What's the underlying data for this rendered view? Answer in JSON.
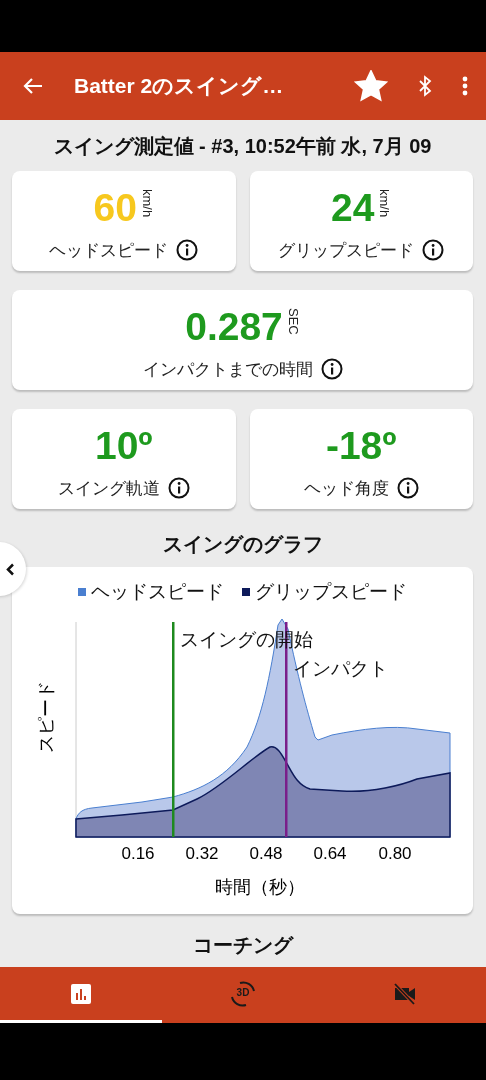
{
  "app_bar": {
    "title": "Batter 2のスイング…",
    "favorite": true
  },
  "heading": "スイング測定値 - #3, 10:52午前 水, 7月 09",
  "metric_rows": [
    [
      {
        "value": "60",
        "unit": "km/h",
        "label": "ヘッドスピード",
        "color": "#f7c81e"
      },
      {
        "value": "24",
        "unit": "km/h",
        "label": "グリップスピード",
        "color": "#1e9a1e"
      }
    ],
    [
      {
        "value": "0.287",
        "unit": "SEC",
        "label": "インパクトまでの時間",
        "color": "#1e9a1e"
      }
    ],
    [
      {
        "value": "10º",
        "label": "スイング軌道",
        "color": "#1e9a1e"
      },
      {
        "value": "-18º",
        "label": "ヘッド角度",
        "color": "#1e9a1e"
      }
    ]
  ],
  "chart": {
    "title": "スイングのグラフ",
    "legend": [
      {
        "label": "ヘッドスピード",
        "color": "#4a7fd0"
      },
      {
        "label": "グリップスピード",
        "color": "#0d1a5a"
      }
    ],
    "markers": [
      {
        "label": "スイングの開始",
        "color": "#1e8a1e"
      },
      {
        "label": "インパクト",
        "color": "#7a1f8a"
      }
    ],
    "x_tick_labels": [
      "0.16",
      "0.32",
      "0.48",
      "0.64",
      "0.80"
    ],
    "xlabel": "時間（秒）",
    "ylabel": "スピード"
  },
  "section_heading": "コーチング",
  "bottom_nav": [
    {
      "kind": "chart",
      "selected": true
    },
    {
      "kind": "rotate-3d",
      "badge": "3D",
      "selected": false
    },
    {
      "kind": "video-off",
      "selected": false
    }
  ]
}
